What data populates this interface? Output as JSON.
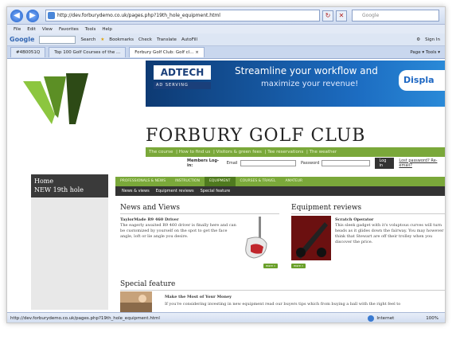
{
  "browser": {
    "url": "http://dev.forburydemo.co.uk/pages.php?19th_hole_equipment.html",
    "search_placeholder": "Google",
    "menu": [
      "File",
      "Edit",
      "View",
      "Favorites",
      "Tools",
      "Help"
    ],
    "toolbar": {
      "google": "Google",
      "search": "Search",
      "bookmarks": "Bookmarks",
      "check": "Check",
      "translate": "Translate",
      "autofill": "AutoFill",
      "sign_in": "Sign In"
    },
    "tabs": [
      "Top 100 Golf Courses of the ...",
      "Forbury Golf Club: Golf cl..."
    ],
    "tab_prefix": "#4B0051Q",
    "commands": "Page ▾  Tools ▾",
    "status_url": "http://dev.forburydemo.co.uk/pages.php?19th_hole_equipment.html",
    "zone": "Internet",
    "zoom": "100%"
  },
  "ad": {
    "brand": "ADTECH",
    "brand_sub": "AD SERVING",
    "headline": "Streamline your workflow and",
    "tagline": "maximize your revenue!",
    "display": "Displa"
  },
  "site": {
    "name": "FORBURY GOLF CLUB",
    "top_nav": [
      "The course",
      "How to find us",
      "Visitors & green fees",
      "Tee reservations",
      "The weather"
    ],
    "login": {
      "label": "Members Log-in:",
      "email": "Email",
      "password": "Password",
      "button": "Log in",
      "forgot": "Lost password? Re-email?"
    },
    "side": {
      "home": "Home",
      "item": "NEW 19th hole"
    },
    "main_nav": [
      "PROFESSIONALS & NEWS",
      "INSTRUCTION",
      "EQUIPMENT",
      "COURSES & TRAVEL",
      "AMATEUR"
    ],
    "sub_nav": [
      "News & views",
      "Equipment reviews",
      "Special feature"
    ]
  },
  "news": {
    "heading": "News and Views",
    "title": "TaylorMade R9 460 Driver",
    "text": "The eagerly awaited R9 460 driver is finally here and can be customized by yourself on the spot to get the face angle, loft or lie angle you desire.",
    "more": "more »"
  },
  "review": {
    "heading": "Equipment reviews",
    "title": "Scratch Operator",
    "text": "This sleek gadget with it's voluptous curves will turn heads as it glides down the fairway. You may however think that Stewart are off their trolley when you discover the price.",
    "more": "more »"
  },
  "feature": {
    "heading": "Special feature",
    "title": "Make the Most of Your Money",
    "text": "If you're considering investing in new equipment read our buyers tips which from buying a ball with the right feel to"
  }
}
